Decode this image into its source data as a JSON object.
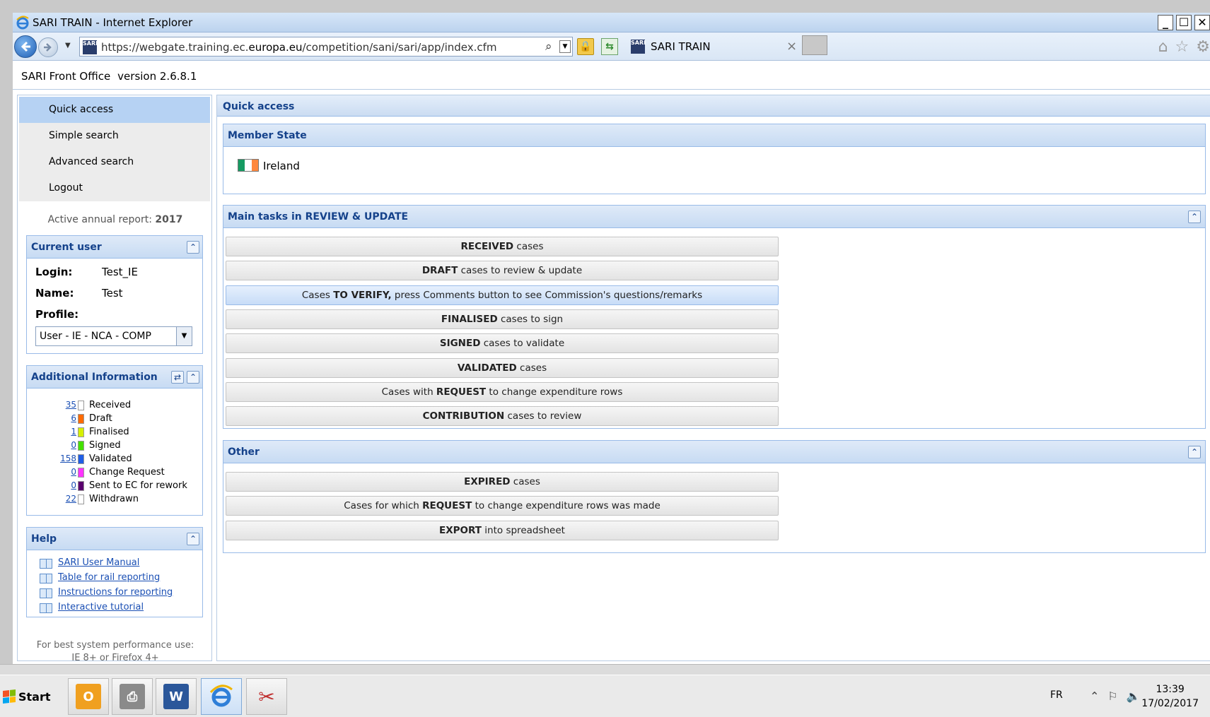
{
  "window": {
    "title": "SARI TRAIN - Internet Explorer"
  },
  "browser": {
    "url_prefix": "https://webgate.training.ec.",
    "url_domain": "europa.eu",
    "url_path": "/competition/sani/sari/app/index.cfm",
    "tab_label": "SARI TRAIN",
    "site_icon_text": "SARI"
  },
  "app": {
    "name": "SARI Front Office",
    "version": "version 2.6.8.1"
  },
  "sidebar": {
    "nav": [
      {
        "label": "Quick access",
        "active": true
      },
      {
        "label": "Simple search"
      },
      {
        "label": "Advanced search"
      },
      {
        "label": "Logout"
      }
    ],
    "annual_label": "Active annual report:",
    "annual_year": "2017"
  },
  "current_user": {
    "title": "Current user",
    "login_label": "Login:",
    "login_value": "Test_IE",
    "name_label": "Name:",
    "name_value": "Test",
    "profile_label": "Profile:",
    "profile_value": "User - IE - NCA - COMP"
  },
  "additional_info": {
    "title": "Additional Information",
    "items": [
      {
        "count": "35",
        "label": "Received",
        "color": "#ffffff"
      },
      {
        "count": "6",
        "label": "Draft",
        "color": "#ff6a00"
      },
      {
        "count": "1",
        "label": "Finalised",
        "color": "#d6f000"
      },
      {
        "count": "0",
        "label": "Signed",
        "color": "#44e000"
      },
      {
        "count": "158",
        "label": "Validated",
        "color": "#1f5ee6"
      },
      {
        "count": "0",
        "label": "Change Request",
        "color": "#ff33ff"
      },
      {
        "count": "0",
        "label": "Sent to EC for rework",
        "color": "#5a006e"
      },
      {
        "count": "22",
        "label": "Withdrawn",
        "color": "#ffffff"
      }
    ]
  },
  "help": {
    "title": "Help",
    "links": [
      "SARI User Manual",
      "Table for rail reporting",
      "Instructions for reporting",
      "Interactive tutorial"
    ]
  },
  "best_perf": {
    "line1": "For best system performance use:",
    "line2": "IE 8+ or Firefox 4+"
  },
  "main": {
    "title": "Quick access",
    "member_state": {
      "title": "Member State",
      "country": "Ireland"
    },
    "tasks": {
      "title": "Main tasks in REVIEW & UPDATE",
      "buttons": [
        {
          "bold": "RECEIVED",
          "rest": " cases"
        },
        {
          "bold": "DRAFT",
          "rest": " cases to review & update"
        },
        {
          "pre": "Cases ",
          "bold": "TO VERIFY,",
          "rest": " press Comments button to see Commission's questions/remarks",
          "highlight": true
        },
        {
          "bold": "FINALISED",
          "rest": " cases to sign"
        },
        {
          "bold": "SIGNED",
          "rest": " cases to validate"
        },
        {
          "bold": "VALIDATED",
          "rest": " cases"
        },
        {
          "pre": "Cases with ",
          "bold": "REQUEST",
          "rest": " to change expenditure rows"
        },
        {
          "bold": "CONTRIBUTION",
          "rest": " cases to review"
        }
      ]
    },
    "other": {
      "title": "Other",
      "buttons": [
        {
          "bold": "EXPIRED",
          "rest": " cases"
        },
        {
          "pre": "Cases for which ",
          "bold": "REQUEST",
          "rest": " to change expenditure rows was made"
        },
        {
          "bold": "EXPORT",
          "rest": " into spreadsheet"
        }
      ]
    }
  },
  "taskbar": {
    "start_label": "Start",
    "lang": "FR",
    "time": "13:39",
    "date": "17/02/2017"
  }
}
